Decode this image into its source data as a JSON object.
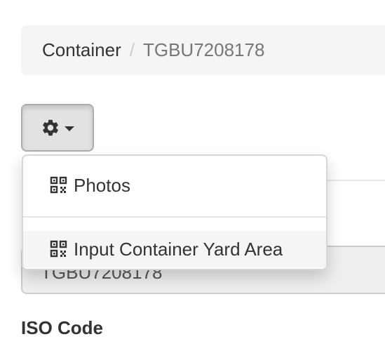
{
  "breadcrumb": {
    "items": [
      {
        "label": "Container"
      },
      {
        "label": "TGBU7208178"
      }
    ],
    "separator": "/"
  },
  "actions": {
    "gear_icon": "gear-icon",
    "caret_icon": "caret-down-icon"
  },
  "dropdown": {
    "items": [
      {
        "label": "Photos",
        "icon": "qrcode-icon"
      },
      {
        "label": "Input Container Yard Area",
        "icon": "qrcode-icon"
      }
    ]
  },
  "form": {
    "container_number_value": "TGBU7208178",
    "iso_code_label": "ISO Code"
  },
  "colors": {
    "breadcrumb_bg": "#f5f5f5",
    "button_active_bg": "#e2e2e2",
    "input_disabled_bg": "#eeeeee",
    "text": "#333333",
    "muted_text": "#777777"
  }
}
